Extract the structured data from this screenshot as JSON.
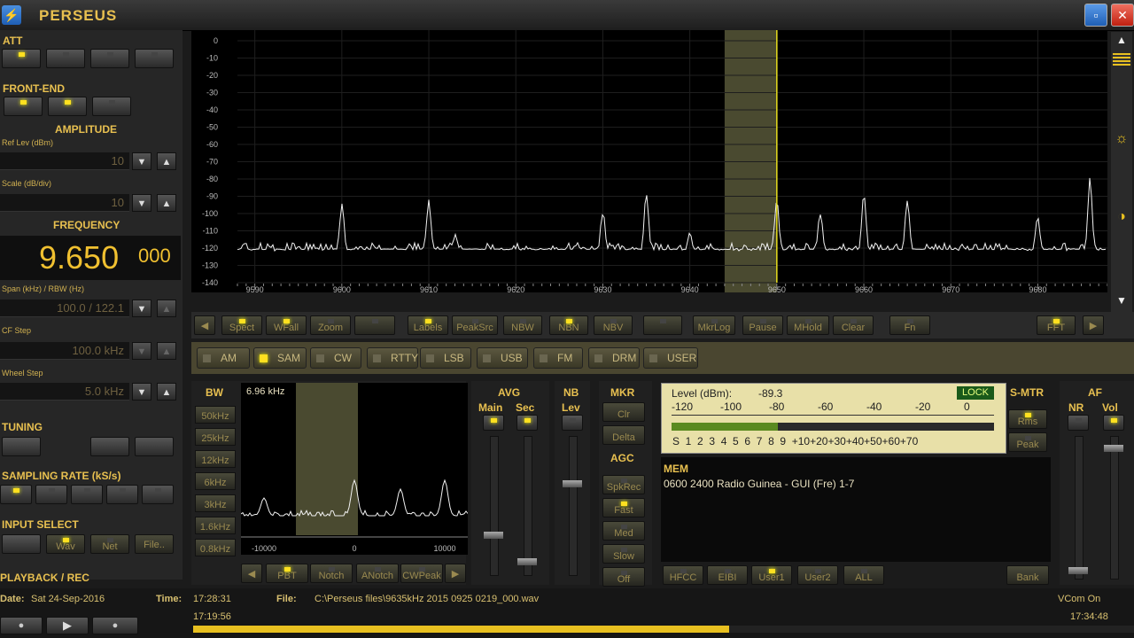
{
  "titlebar": {
    "title": "PERSEUS",
    "minimize": "▫",
    "close": "✕"
  },
  "left": {
    "att": "ATT",
    "frontend": "FRONT-END",
    "amplitude": "AMPLITUDE",
    "ref_lev_label": "Ref Lev (dBm)",
    "ref_lev_value": "10",
    "scale_label": "Scale (dB/div)",
    "scale_value": "10",
    "frequency": "FREQUENCY",
    "freq_main": "9.650",
    "freq_sub": "000",
    "span_label": "Span (kHz) / RBW (Hz)",
    "span_value": "100.0 / 122.1",
    "cf_step_label": "CF Step",
    "cf_step_value": "100.0 kHz",
    "wheel_step_label": "Wheel Step",
    "wheel_step_value": "5.0 kHz",
    "tuning": "TUNING",
    "sampling_rate": "SAMPLING RATE (kS/s)",
    "input_select": "INPUT SELECT",
    "wav_label": "Wav",
    "net_label": "Net",
    "file_label": "File..",
    "playback": "PLAYBACK / REC"
  },
  "spectrum": {
    "y_ticks": [
      "0",
      "-10",
      "-20",
      "-30",
      "-40",
      "-50",
      "-60",
      "-70",
      "-80",
      "-90",
      "-100",
      "-110",
      "-120",
      "-130",
      "-140"
    ],
    "x_ticks": [
      "9590",
      "9600",
      "9610",
      "9620",
      "9630",
      "9640",
      "9650",
      "9660",
      "9670",
      "9680"
    ],
    "ylim": [
      -140,
      0
    ],
    "xlim": [
      9588,
      9688
    ],
    "peaks": [
      [
        9600,
        -95
      ],
      [
        9610,
        -93
      ],
      [
        9613,
        -113
      ],
      [
        9620,
        -120
      ],
      [
        9627,
        -117
      ],
      [
        9630,
        -99
      ],
      [
        9635,
        -88
      ],
      [
        9640,
        -110
      ],
      [
        9650,
        -93
      ],
      [
        9655,
        -100
      ],
      [
        9660,
        -90
      ],
      [
        9665,
        -94
      ],
      [
        9680,
        -103
      ],
      [
        9686,
        -80
      ]
    ],
    "floor": -122,
    "passband": [
      9644,
      9650
    ],
    "marker": 9650
  },
  "toolbar": {
    "buttons": [
      "Spect",
      "WFall",
      "Zoom",
      "",
      "Labels",
      "PeakSrc",
      "NBW",
      "NBN",
      "NBV",
      "",
      "MkrLog",
      "Pause",
      "MHold",
      "Clear",
      "Fn",
      "FFT"
    ]
  },
  "modes": [
    "AM",
    "SAM",
    "CW",
    "RTTY",
    "LSB",
    "USB",
    "FM",
    "DRM",
    "USER"
  ],
  "bw": {
    "label": "BW",
    "value": "6.96 kHz",
    "buttons": [
      "50kHz",
      "25kHz",
      "12kHz",
      "6kHz",
      "3kHz",
      "1.6kHz",
      "0.8kHz"
    ],
    "x_ticks": [
      "-10000",
      "0",
      "10000"
    ]
  },
  "filter_buttons": [
    "PBT",
    "Notch",
    "ANotch",
    "CWPeak"
  ],
  "avg": {
    "label": "AVG",
    "main": "Main",
    "sec": "Sec"
  },
  "nb": {
    "label": "NB",
    "lev": "Lev"
  },
  "mkr": {
    "label": "MKR",
    "clr": "Clr",
    "delta": "Delta"
  },
  "agc": {
    "label": "AGC",
    "buttons": [
      "SpkRec",
      "Fast",
      "Med",
      "Slow",
      "Off"
    ]
  },
  "meter": {
    "level_label": "Level (dBm):",
    "level_value": "-89.3",
    "lock": "LOCK",
    "dbm_scale": [
      "-120",
      "-100",
      "-80",
      "-60",
      "-40",
      "-20",
      "0"
    ],
    "s_scale": "S  1  2  3  4  5  6  7  8  9  +10+20+30+40+50+60+70",
    "level_fraction": 0.33
  },
  "smtr": {
    "label": "S-MTR",
    "rms": "Rms",
    "peak": "Peak"
  },
  "af": {
    "label": "AF",
    "nr": "NR",
    "vol": "Vol"
  },
  "mem": {
    "label": "MEM",
    "entry": "0600 2400 Radio Guinea  - GUI (Fre)   1-7",
    "buttons": [
      "HFCC",
      "EIBI",
      "User1",
      "User2",
      "ALL"
    ],
    "bank": "Bank"
  },
  "status": {
    "date_label": "Date:",
    "date_value": "Sat 24-Sep-2016",
    "time_label": "Time:",
    "time_value": "17:28:31",
    "file_label": "File:",
    "file_value": "C:\\Perseus files\\9635kHz 2015 0925 0219_000.wav",
    "vcom": "VCom On",
    "start_time": "17:19:56",
    "end_time": "17:34:48",
    "progress": 0.57
  }
}
